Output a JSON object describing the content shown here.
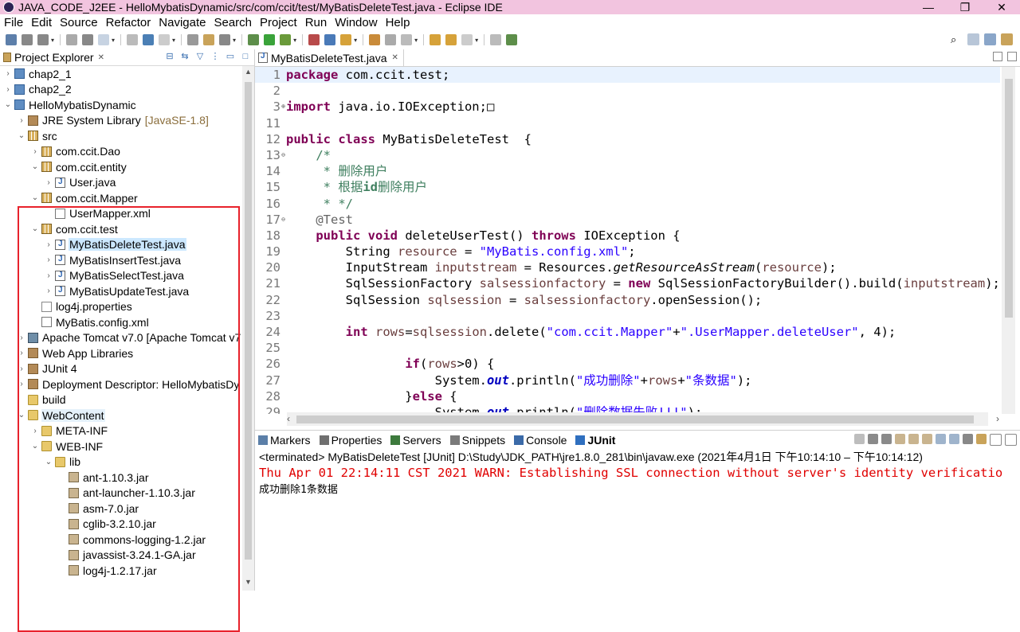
{
  "window": {
    "title": "JAVA_CODE_J2EE - HelloMybatisDynamic/src/com/ccit/test/MyBatisDeleteTest.java - Eclipse IDE"
  },
  "menu": [
    "File",
    "Edit",
    "Source",
    "Refactor",
    "Navigate",
    "Search",
    "Project",
    "Run",
    "Window",
    "Help"
  ],
  "explorer": {
    "title": "Project Explorer",
    "tree": [
      {
        "label": "chap2_1",
        "indent": 0,
        "arrow": "›",
        "icon": "project"
      },
      {
        "label": "chap2_2",
        "indent": 0,
        "arrow": "›",
        "icon": "project"
      },
      {
        "label": "HelloMybatisDynamic",
        "indent": 0,
        "arrow": "⌄",
        "icon": "project"
      },
      {
        "label": "JRE System Library",
        "decoration": "[JavaSE-1.8]",
        "indent": 1,
        "arrow": "›",
        "icon": "lib"
      },
      {
        "label": "src",
        "indent": 1,
        "arrow": "⌄",
        "icon": "pkg"
      },
      {
        "label": "com.ccit.Dao",
        "indent": 2,
        "arrow": "›",
        "icon": "pkg"
      },
      {
        "label": "com.ccit.entity",
        "indent": 2,
        "arrow": "⌄",
        "icon": "pkg"
      },
      {
        "label": "User.java",
        "indent": 3,
        "arrow": "›",
        "icon": "java"
      },
      {
        "label": "com.ccit.Mapper",
        "indent": 2,
        "arrow": "⌄",
        "icon": "pkg"
      },
      {
        "label": "UserMapper.xml",
        "indent": 3,
        "arrow": "",
        "icon": "xml"
      },
      {
        "label": "com.ccit.test",
        "indent": 2,
        "arrow": "⌄",
        "icon": "pkg"
      },
      {
        "label": "MyBatisDeleteTest.java",
        "indent": 3,
        "arrow": "›",
        "icon": "java",
        "selected": true
      },
      {
        "label": "MyBatisInsertTest.java",
        "indent": 3,
        "arrow": "›",
        "icon": "java"
      },
      {
        "label": "MyBatisSelectTest.java",
        "indent": 3,
        "arrow": "›",
        "icon": "java"
      },
      {
        "label": "MyBatisUpdateTest.java",
        "indent": 3,
        "arrow": "›",
        "icon": "java"
      },
      {
        "label": "log4j.properties",
        "indent": 2,
        "arrow": "",
        "icon": "props"
      },
      {
        "label": "MyBatis.config.xml",
        "indent": 2,
        "arrow": "",
        "icon": "xml"
      },
      {
        "label": "Apache Tomcat v7.0 [Apache Tomcat v7",
        "indent": 1,
        "arrow": "›",
        "icon": "server"
      },
      {
        "label": "Web App Libraries",
        "indent": 1,
        "arrow": "›",
        "icon": "lib"
      },
      {
        "label": "JUnit 4",
        "indent": 1,
        "arrow": "›",
        "icon": "lib"
      },
      {
        "label": "Deployment Descriptor: HelloMybatisDy",
        "indent": 1,
        "arrow": "›",
        "icon": "lib"
      },
      {
        "label": "build",
        "indent": 1,
        "arrow": "",
        "icon": "folder"
      },
      {
        "label": "WebContent",
        "indent": 1,
        "arrow": "⌄",
        "icon": "folder",
        "highlight": true
      },
      {
        "label": "META-INF",
        "indent": 2,
        "arrow": "›",
        "icon": "folder"
      },
      {
        "label": "WEB-INF",
        "indent": 2,
        "arrow": "⌄",
        "icon": "folder"
      },
      {
        "label": "lib",
        "indent": 3,
        "arrow": "⌄",
        "icon": "folder"
      },
      {
        "label": "ant-1.10.3.jar",
        "indent": 4,
        "arrow": "",
        "icon": "jar"
      },
      {
        "label": "ant-launcher-1.10.3.jar",
        "indent": 4,
        "arrow": "",
        "icon": "jar"
      },
      {
        "label": "asm-7.0.jar",
        "indent": 4,
        "arrow": "",
        "icon": "jar"
      },
      {
        "label": "cglib-3.2.10.jar",
        "indent": 4,
        "arrow": "",
        "icon": "jar"
      },
      {
        "label": "commons-logging-1.2.jar",
        "indent": 4,
        "arrow": "",
        "icon": "jar"
      },
      {
        "label": "javassist-3.24.1-GA.jar",
        "indent": 4,
        "arrow": "",
        "icon": "jar"
      },
      {
        "label": "log4j-1.2.17.jar",
        "indent": 4,
        "arrow": "",
        "icon": "jar"
      }
    ]
  },
  "editor": {
    "tab": "MyBatisDeleteTest.java",
    "lines": [
      {
        "n": "1",
        "fold": "",
        "current": true,
        "html": "<span class='kw'>package</span> com.ccit.test;"
      },
      {
        "n": "2",
        "fold": "",
        "html": ""
      },
      {
        "n": "3",
        "fold": "⊕",
        "html": "<span class='kw'>import</span> java.io.IOException;□"
      },
      {
        "n": "11",
        "fold": "",
        "html": ""
      },
      {
        "n": "12",
        "fold": "",
        "html": "<span class='kw'>public</span> <span class='kw'>class</span> MyBatisDeleteTest  {"
      },
      {
        "n": "13",
        "fold": "⊖",
        "html": "    <span class='cmt'>/*</span>"
      },
      {
        "n": "14",
        "fold": "",
        "html": "<span class='cmt'>     * 删除用户</span>"
      },
      {
        "n": "15",
        "fold": "",
        "html": "<span class='cmt'>     * 根据<b>id</b>删除用户</span>"
      },
      {
        "n": "16",
        "fold": "",
        "html": "<span class='cmt'>     * */</span>"
      },
      {
        "n": "17",
        "fold": "⊖",
        "html": "    <span class='ann'>@Test</span>"
      },
      {
        "n": "18",
        "fold": "",
        "html": "    <span class='kw'>public</span> <span class='kw'>void</span> deleteUserTest() <span class='kw'>throws</span> IOException {"
      },
      {
        "n": "19",
        "fold": "",
        "html": "        String <span class='var'>resource</span> = <span class='str'>\"MyBatis.config.xml\"</span>;"
      },
      {
        "n": "20",
        "fold": "",
        "html": "        InputStream <span class='var'>inputstream</span> = Resources.<span class='ital'>getResourceAsStream</span>(<span class='var'>resource</span>);"
      },
      {
        "n": "21",
        "fold": "",
        "html": "        SqlSessionFactory <span class='var'>salsessionfactory</span> = <span class='kw'>new</span> SqlSessionFactoryBuilder().build(<span class='var'>inputstream</span>);"
      },
      {
        "n": "22",
        "fold": "",
        "html": "        SqlSession <span class='var'>sqlsession</span> = <span class='var'>salsessionfactory</span>.openSession();"
      },
      {
        "n": "23",
        "fold": "",
        "html": ""
      },
      {
        "n": "24",
        "fold": "",
        "html": "        <span class='kw'>int</span> <span class='var'>rows</span>=<span class='var'>sqlsession</span>.delete(<span class='str'>\"com.ccit.Mapper\"</span>+<span class='str'>\".UserMapper.deleteUser\"</span>, 4);"
      },
      {
        "n": "25",
        "fold": "",
        "html": ""
      },
      {
        "n": "26",
        "fold": "",
        "html": "                <span class='kw'>if</span>(<span class='var'>rows</span>&gt;0) {"
      },
      {
        "n": "27",
        "fold": "",
        "html": "                    System.<span class='fld'>out</span>.println(<span class='str'>\"成功删除\"</span>+<span class='var'>rows</span>+<span class='str'>\"条数据\"</span>);"
      },
      {
        "n": "28",
        "fold": "",
        "html": "                }<span class='kw'>else</span> {"
      },
      {
        "n": "29",
        "fold": "",
        "html": "                    System.<span class='fld'>out</span>.println(<span class='str'>\"删除数据失败!!!\"</span>);"
      }
    ]
  },
  "console": {
    "tabs": [
      {
        "label": "Markers",
        "icon": "#5b7fa8"
      },
      {
        "label": "Properties",
        "icon": "#6f6f6f"
      },
      {
        "label": "Servers",
        "icon": "#3d7a3d"
      },
      {
        "label": "Snippets",
        "icon": "#7a7a7a"
      },
      {
        "label": "Console",
        "icon": "#3b6aa8",
        "active": true
      },
      {
        "label": "JUnit",
        "icon": "#2f6fbf",
        "bold": true
      }
    ],
    "status": "<terminated> MyBatisDeleteTest [JUnit] D:\\Study\\JDK_PATH\\jre1.8.0_281\\bin\\javaw.exe  (2021年4月1日 下午10:14:10 – 下午10:14:12)",
    "output_err": "Thu Apr 01 22:14:11 CST 2021 WARN: Establishing SSL connection without server's identity verificatio",
    "output_ok": "成功删除1条数据"
  }
}
